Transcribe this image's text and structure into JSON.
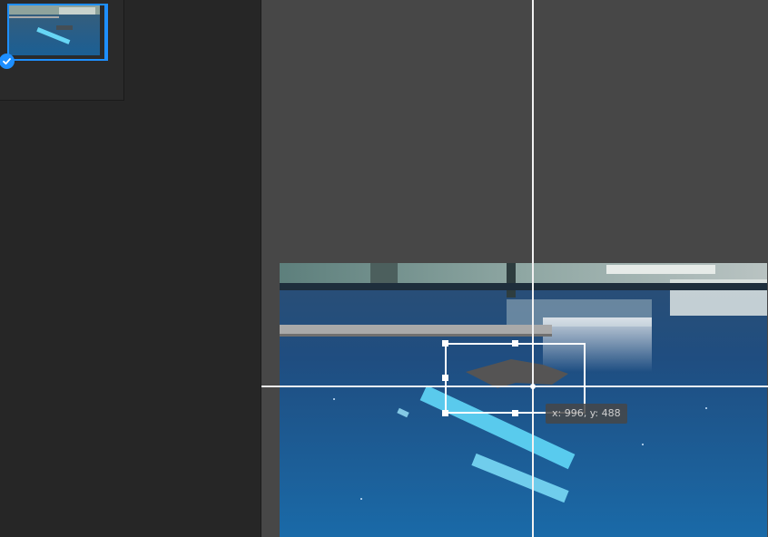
{
  "thumbnails": [
    {
      "selected": true,
      "icon": "checkmark-icon"
    }
  ],
  "canvas": {
    "cursor_readout": "x: 996, y: 488"
  },
  "colors": {
    "accent": "#1e8fff",
    "canvas_bg": "#474747",
    "panel_bg": "#262626",
    "crosshair": "#f2f2f2"
  }
}
